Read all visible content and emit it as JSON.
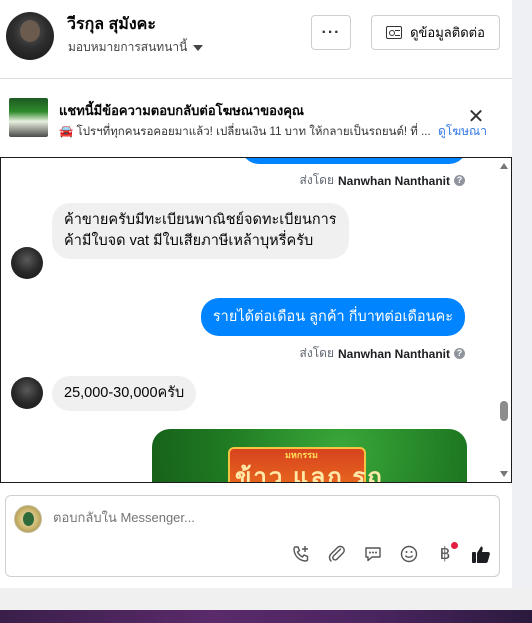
{
  "header": {
    "name": "วีรกุล สุมังคะ",
    "subtitle": "มอบหมายการสนทนานี้",
    "more_label": "···",
    "contact_label": "ดูข้อมูลติดต่อ"
  },
  "ad": {
    "title": "แชทนี้มีข้อความตอบกลับต่อโฆษณาของคุณ",
    "text": "🚘 โปรฯที่ทุกคนรอคอยมาแล้ว! เปลี่ยนเงิน 11 บาท ให้กลายเป็นรถยนต์! ที่ ...",
    "link_label": "ดูโฆษณา",
    "close_label": "✕"
  },
  "messages": {
    "sent_by_prefix": "ส่งโดย",
    "sent_by_name": "Nanwhan Nanthanit",
    "info_icon": "?",
    "incoming_1": "ค้าขายครับมีทะเบียนพาณิชย์จดทะเบียนการค้ามีใบจด vat มีใบเสียภาษีเหล้าบุหรี่ครับ",
    "outgoing_1": "รายได้ต่อเดือน ลูกค้า   กี่บาทต่อเดือนคะ",
    "incoming_2": "25,000-30,000ครับ",
    "promo_tag": "มหกรรม",
    "promo_word": "ข้าว แลก รถ"
  },
  "composer": {
    "placeholder": "ตอบกลับใน Messenger...",
    "icons": [
      "phone-plus-icon",
      "paperclip-icon",
      "chat-bubble-icon",
      "smiley-icon",
      "baht-icon",
      "thumbs-up-icon"
    ],
    "baht_symbol": "฿"
  },
  "colors": {
    "accent": "#0084ff",
    "link": "#3578e5",
    "bubble_in": "#f1f0f0"
  }
}
